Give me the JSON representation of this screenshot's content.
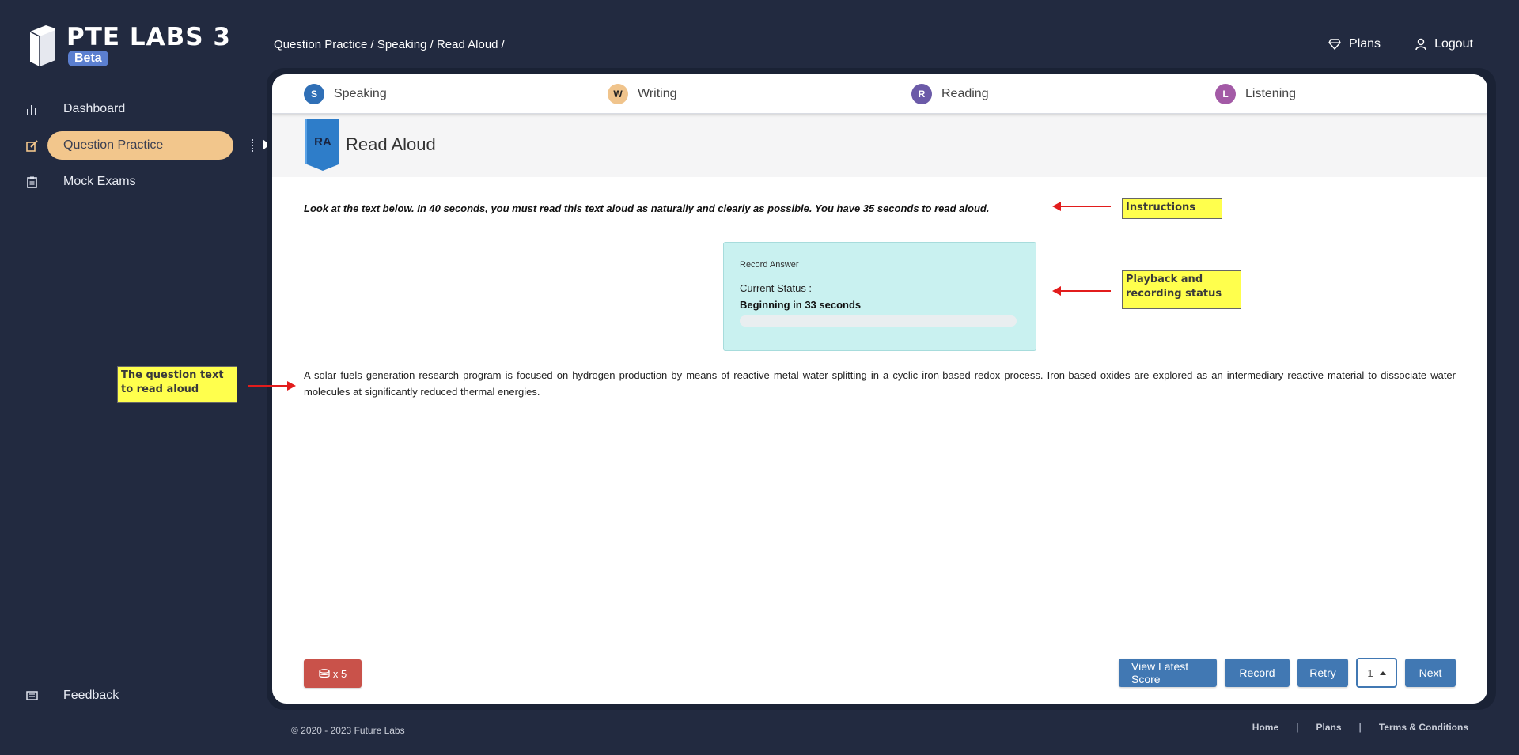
{
  "app": {
    "title": "PTE LABS 3",
    "badge": "Beta"
  },
  "sidebar": {
    "items": [
      {
        "label": "Dashboard",
        "icon": "bar-chart-icon"
      },
      {
        "label": "Question Practice",
        "icon": "edit-icon",
        "active": true
      },
      {
        "label": "Mock Exams",
        "icon": "clipboard-icon"
      }
    ],
    "feedback": {
      "label": "Feedback",
      "icon": "feedback-icon"
    }
  },
  "header": {
    "breadcrumb": "Question Practice / Speaking / Read Aloud /",
    "plans": "Plans",
    "logout": "Logout"
  },
  "tabs": [
    {
      "label": "Speaking",
      "icon_letter": "S",
      "color": "#2f6fb6"
    },
    {
      "label": "Writing",
      "icon_letter": "W",
      "color": "#f0c48c"
    },
    {
      "label": "Reading",
      "icon_letter": "R",
      "color": "#6b5aa8"
    },
    {
      "label": "Listening",
      "icon_letter": "L",
      "color": "#a35aa6"
    }
  ],
  "section": {
    "badge": "RA",
    "title": "Read Aloud"
  },
  "instructions": "Look at the text below. In 40 seconds, you must read this text aloud as naturally and clearly as possible. You have 35 seconds to read aloud.",
  "recorder": {
    "title": "Record Answer",
    "status_label": "Current Status :",
    "status": "Beginning in 33 seconds",
    "progress": 0
  },
  "question_text": "A solar fuels generation research program is focused on hydrogen production by means of reactive metal water splitting in a cyclic iron-based redox process. Iron-based oxides are explored as an intermediary reactive material to dissociate water molecules at significantly reduced thermal energies.",
  "actions": {
    "attempts": "x 5",
    "view_score": "View Latest Score",
    "record": "Record",
    "retry": "Retry",
    "page": "1",
    "next": "Next"
  },
  "footer": {
    "copyright": "© 2020 - 2023 Future Labs",
    "links": [
      "Home",
      "Plans",
      "Terms & Conditions"
    ],
    "separator": "|"
  },
  "annotations": {
    "instructions": "Instructions",
    "recorder": "Playback and recording status",
    "question": "The question text to read aloud"
  },
  "colors": {
    "background": "#222a40",
    "accent": "#f2c68c",
    "primary_button": "#4178b3",
    "danger_button": "#c9524a",
    "recorder_bg": "#c9f1f0"
  }
}
